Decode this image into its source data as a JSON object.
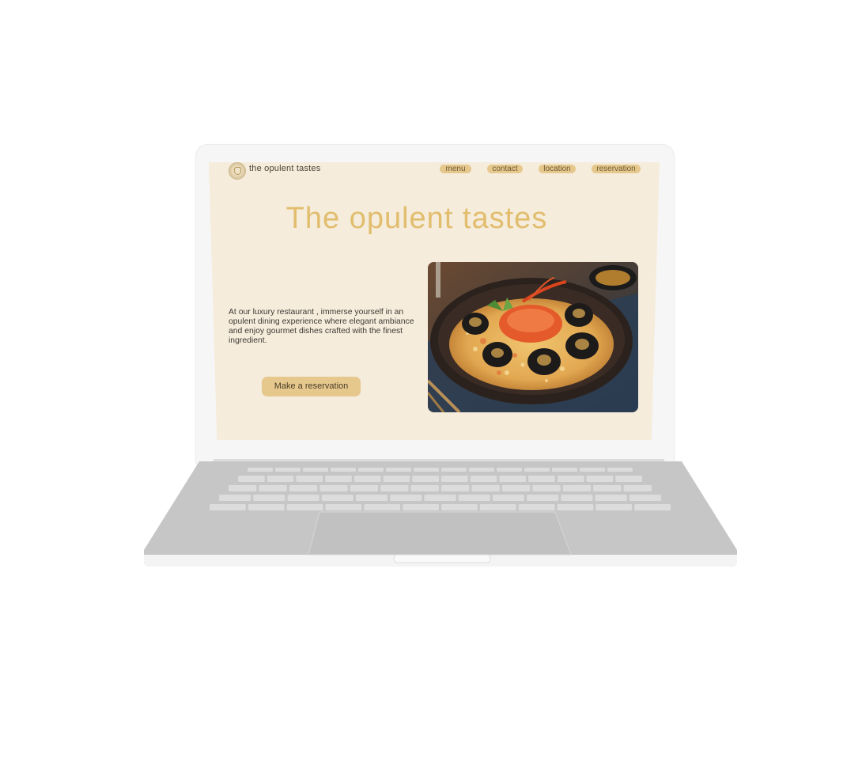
{
  "site": {
    "brand": "the opulent tastes",
    "nav": [
      {
        "label": "menu"
      },
      {
        "label": "contact"
      },
      {
        "label": "location"
      },
      {
        "label": "reservation"
      }
    ],
    "hero_title": "The opulent tastes",
    "hero_text": "At our luxury restaurant , immerse yourself in an opulent dining experience where elegant ambiance and enjoy gourmet dishes crafted with the finest ingredient.",
    "cta": "Make a reservation"
  },
  "colors": {
    "background": "#f5ecdc",
    "accent": "#e6c88d",
    "title": "#e1bd6d",
    "text": "#3e3a33"
  },
  "icons": {
    "logo": "restaurant-emblem-icon"
  }
}
